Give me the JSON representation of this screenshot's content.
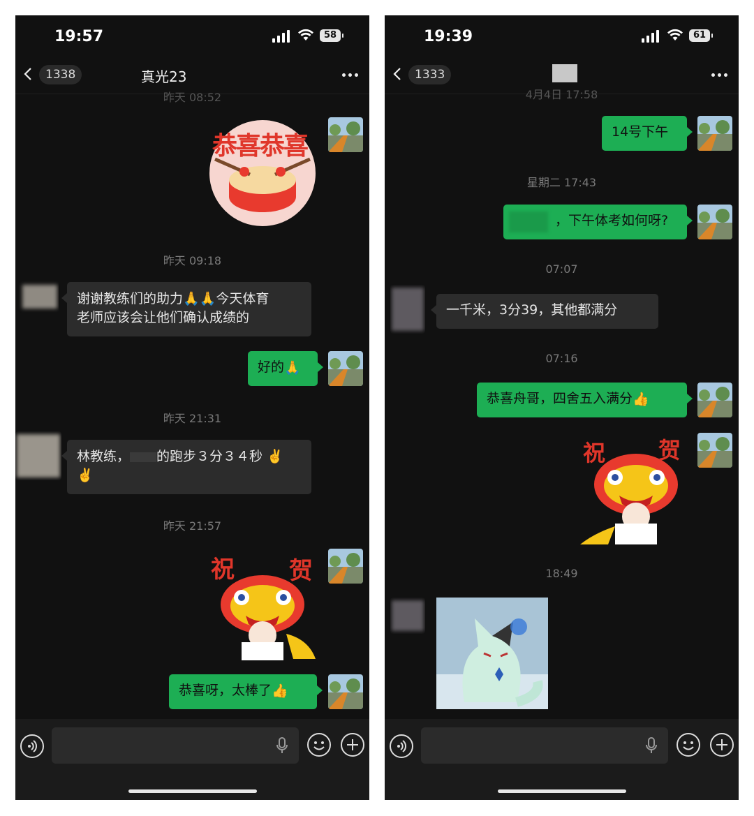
{
  "left": {
    "status": {
      "time": "19:57",
      "battery": "58"
    },
    "nav": {
      "back_count": "1338",
      "title": "真光23"
    },
    "timestamps": [
      "昨天 08:52",
      "昨天 09:18",
      "昨天 21:31",
      "昨天 21:57"
    ],
    "stickers": {
      "congrats_drum_text": "恭喜恭喜",
      "lion_left_char": "祝",
      "lion_right_char": "贺"
    },
    "messages": {
      "m1_line1": "谢谢教练们的助力",
      "m1_line1_tail": "今天体育",
      "m1_line2": "老师应该会让他们确认成绩的",
      "m2": "好的",
      "m3_line1_a": "林教练，",
      "m3_line1_b": "的跑步３分３４秒",
      "m4": "恭喜呀，太棒了"
    }
  },
  "right": {
    "status": {
      "time": "19:39",
      "battery": "61"
    },
    "nav": {
      "back_count": "1333"
    },
    "timestamps": [
      "4月4日 17:58",
      "星期二 17:43",
      "07:07",
      "07:16",
      "18:49"
    ],
    "stickers": {
      "lion_left_char": "祝",
      "lion_right_char": "贺"
    },
    "messages": {
      "m1": "14号下午",
      "m2": "，下午体考如何呀?",
      "m3": "一千米，3分39，其他都满分",
      "m4": "恭喜舟哥，四舍五入满分"
    }
  },
  "icons": [
    "chevron-left-icon",
    "more-icon",
    "voice-icon",
    "mic-icon",
    "smile-icon",
    "plus-icon",
    "clap-emoji",
    "victory-emoji",
    "thumbs-up-emoji"
  ]
}
